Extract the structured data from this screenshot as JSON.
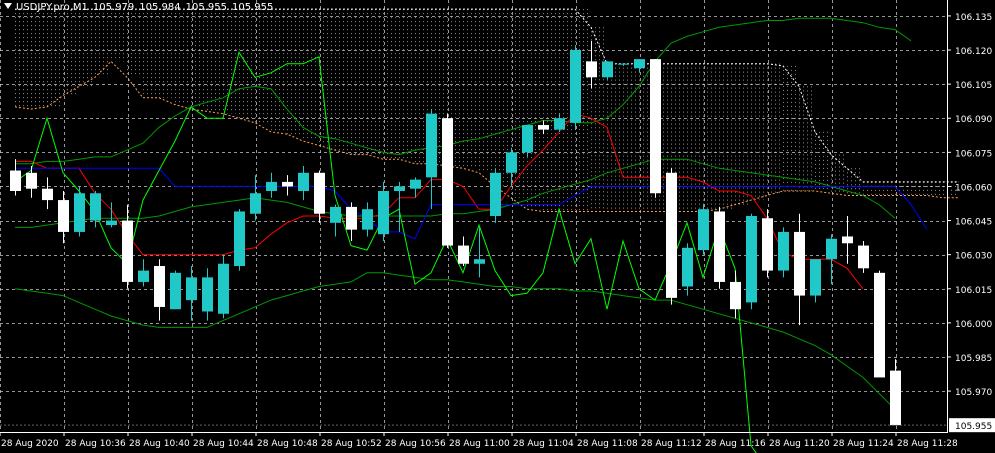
{
  "header": {
    "symbol": "USDJPY.pro,M1",
    "open": "105.979",
    "high": "105.984",
    "low": "105.955",
    "close": "105.955"
  },
  "colors": {
    "background": "#000000",
    "grid": "#c8c8c8",
    "axis": "#ffffff",
    "bull_candle": "#20c8c8",
    "bear_candle": "#ffffff",
    "tenkan": "#ff0000",
    "kijun": "#0000ff",
    "chikou": "#00ff00",
    "senkou_a": "#ffa050",
    "senkou_b": "#ffffff",
    "bollinger": "#009900"
  },
  "chart_data": {
    "type": "candlestick",
    "symbol": "USDJPY.pro",
    "timeframe": "M1",
    "indicators": [
      "Ichimoku Kinko Hyo",
      "Bollinger Bands"
    ],
    "ylim": [
      105.952,
      106.142
    ],
    "current_price": "105.955",
    "y_ticks": [
      "106.135",
      "106.120",
      "106.105",
      "106.090",
      "106.075",
      "106.060",
      "106.045",
      "106.030",
      "106.015",
      "106.000",
      "105.985",
      "105.970"
    ],
    "x_ticks": [
      "28 Aug 2020",
      "28 Aug 10:36",
      "28 Aug 10:40",
      "28 Aug 10:44",
      "28 Aug 10:48",
      "28 Aug 10:52",
      "28 Aug 10:56",
      "28 Aug 11:00",
      "28 Aug 11:04",
      "28 Aug 11:08",
      "28 Aug 11:12",
      "28 Aug 11:16",
      "28 Aug 11:20",
      "28 Aug 11:24",
      "28 Aug 11:28"
    ],
    "candles": [
      {
        "o": 106.067,
        "h": 106.072,
        "l": 106.056,
        "c": 106.058
      },
      {
        "o": 106.066,
        "h": 106.069,
        "l": 106.055,
        "c": 106.059
      },
      {
        "o": 106.059,
        "h": 106.064,
        "l": 106.05,
        "c": 106.054
      },
      {
        "o": 106.054,
        "h": 106.058,
        "l": 106.035,
        "c": 106.04
      },
      {
        "o": 106.04,
        "h": 106.06,
        "l": 106.038,
        "c": 106.057
      },
      {
        "o": 106.045,
        "h": 106.058,
        "l": 106.042,
        "c": 106.057
      },
      {
        "o": 106.043,
        "h": 106.053,
        "l": 106.042,
        "c": 106.045
      },
      {
        "o": 106.045,
        "h": 106.052,
        "l": 106.015,
        "c": 106.018
      },
      {
        "o": 106.018,
        "h": 106.028,
        "l": 106.016,
        "c": 106.023
      },
      {
        "o": 106.025,
        "h": 106.028,
        "l": 106.001,
        "c": 106.007
      },
      {
        "o": 106.006,
        "h": 106.023,
        "l": 106.006,
        "c": 106.022
      },
      {
        "o": 106.01,
        "h": 106.025,
        "l": 106.001,
        "c": 106.02
      },
      {
        "o": 106.005,
        "h": 106.024,
        "l": 106.001,
        "c": 106.02
      },
      {
        "o": 106.004,
        "h": 106.03,
        "l": 106.002,
        "c": 106.026
      },
      {
        "o": 106.025,
        "h": 106.05,
        "l": 106.023,
        "c": 106.049
      },
      {
        "o": 106.048,
        "h": 106.065,
        "l": 106.045,
        "c": 106.057
      },
      {
        "o": 106.058,
        "h": 106.066,
        "l": 106.055,
        "c": 106.062
      },
      {
        "o": 106.062,
        "h": 106.065,
        "l": 106.056,
        "c": 106.06
      },
      {
        "o": 106.058,
        "h": 106.069,
        "l": 106.054,
        "c": 106.066
      },
      {
        "o": 106.066,
        "h": 106.067,
        "l": 106.044,
        "c": 106.048
      },
      {
        "o": 106.044,
        "h": 106.052,
        "l": 106.038,
        "c": 106.051
      },
      {
        "o": 106.051,
        "h": 106.053,
        "l": 106.036,
        "c": 106.041
      },
      {
        "o": 106.041,
        "h": 106.053,
        "l": 106.038,
        "c": 106.05
      },
      {
        "o": 106.039,
        "h": 106.062,
        "l": 106.036,
        "c": 106.058
      },
      {
        "o": 106.058,
        "h": 106.062,
        "l": 106.04,
        "c": 106.06
      },
      {
        "o": 106.059,
        "h": 106.064,
        "l": 106.055,
        "c": 106.063
      },
      {
        "o": 106.064,
        "h": 106.094,
        "l": 106.05,
        "c": 106.092
      },
      {
        "o": 106.09,
        "h": 106.092,
        "l": 106.033,
        "c": 106.034
      },
      {
        "o": 106.034,
        "h": 106.038,
        "l": 106.025,
        "c": 106.026
      },
      {
        "o": 106.026,
        "h": 106.042,
        "l": 106.02,
        "c": 106.028
      },
      {
        "o": 106.047,
        "h": 106.068,
        "l": 106.044,
        "c": 106.066
      },
      {
        "o": 106.066,
        "h": 106.077,
        "l": 106.06,
        "c": 106.075
      },
      {
        "o": 106.075,
        "h": 106.086,
        "l": 106.073,
        "c": 106.087
      },
      {
        "o": 106.087,
        "h": 106.089,
        "l": 106.083,
        "c": 106.085
      },
      {
        "o": 106.085,
        "h": 106.092,
        "l": 106.084,
        "c": 106.09
      },
      {
        "o": 106.088,
        "h": 106.122,
        "l": 106.085,
        "c": 106.12
      },
      {
        "o": 106.115,
        "h": 106.124,
        "l": 106.103,
        "c": 106.108
      },
      {
        "o": 106.108,
        "h": 106.115,
        "l": 106.107,
        "c": 106.115
      },
      {
        "o": 106.114,
        "h": 106.114,
        "l": 106.113,
        "c": 106.114
      },
      {
        "o": 106.112,
        "h": 106.116,
        "l": 106.11,
        "c": 106.116
      },
      {
        "o": 106.116,
        "h": 106.116,
        "l": 106.055,
        "c": 106.057
      },
      {
        "o": 106.066,
        "h": 106.068,
        "l": 106.008,
        "c": 106.011
      },
      {
        "o": 106.016,
        "h": 106.035,
        "l": 106.012,
        "c": 106.033
      },
      {
        "o": 106.032,
        "h": 106.052,
        "l": 106.03,
        "c": 106.05
      },
      {
        "o": 106.049,
        "h": 106.051,
        "l": 106.015,
        "c": 106.018
      },
      {
        "o": 106.018,
        "h": 106.023,
        "l": 106.002,
        "c": 106.006
      },
      {
        "o": 106.009,
        "h": 106.048,
        "l": 106.006,
        "c": 106.047
      },
      {
        "o": 106.046,
        "h": 106.05,
        "l": 106.02,
        "c": 106.023
      },
      {
        "o": 106.023,
        "h": 106.042,
        "l": 106.02,
        "c": 106.04
      },
      {
        "o": 106.04,
        "h": 106.048,
        "l": 105.999,
        "c": 106.012
      },
      {
        "o": 106.012,
        "h": 106.028,
        "l": 106.009,
        "c": 106.028
      },
      {
        "o": 106.028,
        "h": 106.039,
        "l": 106.017,
        "c": 106.037
      },
      {
        "o": 106.038,
        "h": 106.047,
        "l": 106.026,
        "c": 106.035
      },
      {
        "o": 106.034,
        "h": 106.036,
        "l": 106.022,
        "c": 106.024
      },
      {
        "o": 106.022,
        "h": 106.023,
        "l": 105.996,
        "c": 105.976
      },
      {
        "o": 105.979,
        "h": 105.984,
        "l": 105.955,
        "c": 105.955
      }
    ],
    "series": [
      {
        "name": "Tenkan-sen",
        "values": [
          106.071,
          106.071,
          106.068,
          106.068,
          106.068,
          106.057,
          106.05,
          106.039,
          106.03,
          106.03,
          106.03,
          106.03,
          106.03,
          106.03,
          106.032,
          106.033,
          106.039,
          106.044,
          106.047,
          106.047,
          106.046,
          106.046,
          106.046,
          106.048,
          106.055,
          106.055,
          106.063,
          106.063,
          106.06,
          106.05,
          106.05,
          106.06,
          106.069,
          106.076,
          106.084,
          106.092,
          106.09,
          106.086,
          106.064,
          106.064,
          106.064,
          106.064,
          106.064,
          106.062,
          106.058,
          106.058,
          106.056,
          106.046,
          106.031,
          106.028,
          106.028,
          106.028,
          106.024,
          106.015
        ]
      },
      {
        "name": "Kijun-sen",
        "values": [
          106.068,
          106.068,
          106.068,
          106.068,
          106.068,
          106.068,
          106.068,
          106.068,
          106.068,
          106.068,
          106.06,
          106.06,
          106.06,
          106.06,
          106.06,
          106.06,
          106.06,
          106.06,
          106.06,
          106.06,
          106.058,
          106.05,
          106.046,
          106.04,
          106.04,
          106.037,
          106.052,
          106.052,
          106.052,
          106.052,
          106.052,
          106.052,
          106.052,
          106.052,
          106.052,
          106.056,
          106.06,
          106.06,
          106.06,
          106.06,
          106.06,
          106.06,
          106.06,
          106.06,
          106.06,
          106.06,
          106.06,
          106.06,
          106.06,
          106.06,
          106.06,
          106.06,
          106.06,
          106.06,
          106.06,
          106.06,
          106.052,
          106.041
        ]
      },
      {
        "name": "Senkou Span A",
        "values": [
          106.095,
          106.094,
          106.095,
          106.1,
          106.104,
          106.108,
          106.115,
          106.108,
          106.099,
          106.099,
          106.096,
          106.094,
          106.093,
          106.092,
          106.09,
          106.088,
          106.084,
          106.083,
          106.08,
          106.078,
          106.076,
          106.074,
          106.074,
          106.072,
          106.072,
          106.07,
          106.07,
          106.069,
          106.068,
          106.066,
          106.06,
          106.055,
          106.05,
          106.049,
          106.049,
          106.049,
          106.049,
          106.049,
          106.049,
          106.049,
          106.049,
          106.049,
          106.049,
          106.049,
          106.05,
          106.052,
          106.054,
          106.056,
          106.058,
          106.058,
          106.058,
          106.057,
          106.056,
          106.056,
          106.056,
          106.056,
          106.056,
          106.056,
          106.055,
          106.055
        ]
      },
      {
        "name": "Senkou Span B",
        "values": [
          106.138,
          106.138,
          106.138,
          106.138,
          106.138,
          106.138,
          106.138,
          106.138,
          106.138,
          106.138,
          106.138,
          106.138,
          106.138,
          106.138,
          106.138,
          106.138,
          106.138,
          106.138,
          106.138,
          106.138,
          106.138,
          106.138,
          106.138,
          106.138,
          106.138,
          106.138,
          106.138,
          106.138,
          106.138,
          106.138,
          106.138,
          106.138,
          106.138,
          106.138,
          106.138,
          106.138,
          106.13,
          106.114,
          106.114,
          106.114,
          106.114,
          106.114,
          106.114,
          106.114,
          106.114,
          106.114,
          106.114,
          106.114,
          106.113,
          106.104,
          106.084,
          106.074,
          106.068,
          106.062,
          106.062,
          106.062,
          106.062,
          106.062,
          106.062,
          106.062
        ]
      },
      {
        "name": "Chikou Span",
        "values": [
          106.062,
          106.067,
          106.09,
          106.066,
          106.058,
          106.049,
          106.033,
          106.026,
          106.054,
          106.067,
          106.08,
          106.095,
          106.09,
          106.09,
          106.119,
          106.108,
          106.11,
          106.114,
          106.114,
          106.117,
          106.056,
          106.034,
          106.032,
          106.046,
          106.05,
          106.017,
          106.022,
          106.037,
          106.022,
          106.043,
          106.023,
          106.012,
          106.013,
          106.022,
          106.05,
          106.026,
          106.037,
          106.006,
          106.036,
          106.015,
          106.01,
          106.026,
          106.044,
          106.02,
          106.042,
          106.024,
          105.946,
          105.936
        ]
      },
      {
        "name": "Bollinger Upper",
        "values": [
          106.07,
          106.07,
          106.071,
          106.071,
          106.072,
          106.073,
          106.073,
          106.076,
          106.079,
          106.086,
          106.091,
          106.095,
          106.097,
          106.099,
          106.103,
          106.104,
          106.103,
          106.094,
          106.086,
          106.082,
          106.081,
          106.079,
          106.077,
          106.075,
          106.074,
          106.076,
          106.077,
          106.078,
          106.08,
          106.081,
          106.083,
          106.085,
          106.087,
          106.089,
          106.089,
          106.088,
          106.088,
          106.09,
          106.096,
          106.104,
          106.115,
          106.123,
          106.126,
          106.128,
          106.13,
          106.131,
          106.132,
          106.133,
          106.133,
          106.134,
          106.134,
          106.134,
          106.133,
          106.132,
          106.13,
          106.129,
          106.124
        ]
      },
      {
        "name": "Bollinger Middle",
        "values": [
          106.042,
          106.042,
          106.043,
          106.044,
          106.045,
          106.046,
          106.046,
          106.046,
          106.046,
          106.047,
          106.049,
          106.051,
          106.052,
          106.053,
          106.054,
          106.055,
          106.054,
          106.053,
          106.051,
          106.049,
          106.048,
          106.047,
          106.047,
          106.047,
          106.047,
          106.047,
          106.047,
          106.048,
          106.048,
          106.049,
          106.05,
          106.052,
          106.054,
          106.057,
          106.059,
          106.061,
          106.063,
          106.066,
          106.068,
          106.07,
          106.072,
          106.072,
          106.072,
          106.07,
          106.068,
          106.067,
          106.066,
          106.065,
          106.064,
          106.063,
          106.062,
          106.06,
          106.058,
          106.056,
          106.052,
          106.046
        ]
      },
      {
        "name": "Bollinger Lower",
        "values": [
          106.015,
          106.014,
          106.013,
          106.012,
          106.009,
          106.006,
          106.003,
          106.001,
          105.999,
          105.998,
          105.998,
          105.998,
          105.998,
          106.001,
          106.004,
          106.007,
          106.01,
          106.012,
          106.014,
          106.016,
          106.017,
          106.018,
          106.022,
          106.022,
          106.021,
          106.02,
          106.019,
          106.019,
          106.018,
          106.017,
          106.016,
          106.016,
          106.015,
          106.015,
          106.015,
          106.014,
          106.014,
          106.013,
          106.012,
          106.011,
          106.01,
          106.01,
          106.008,
          106.006,
          106.004,
          106.002,
          106.0,
          105.998,
          105.996,
          105.993,
          105.99,
          105.986,
          105.981,
          105.976,
          105.969,
          105.962
        ]
      }
    ]
  }
}
